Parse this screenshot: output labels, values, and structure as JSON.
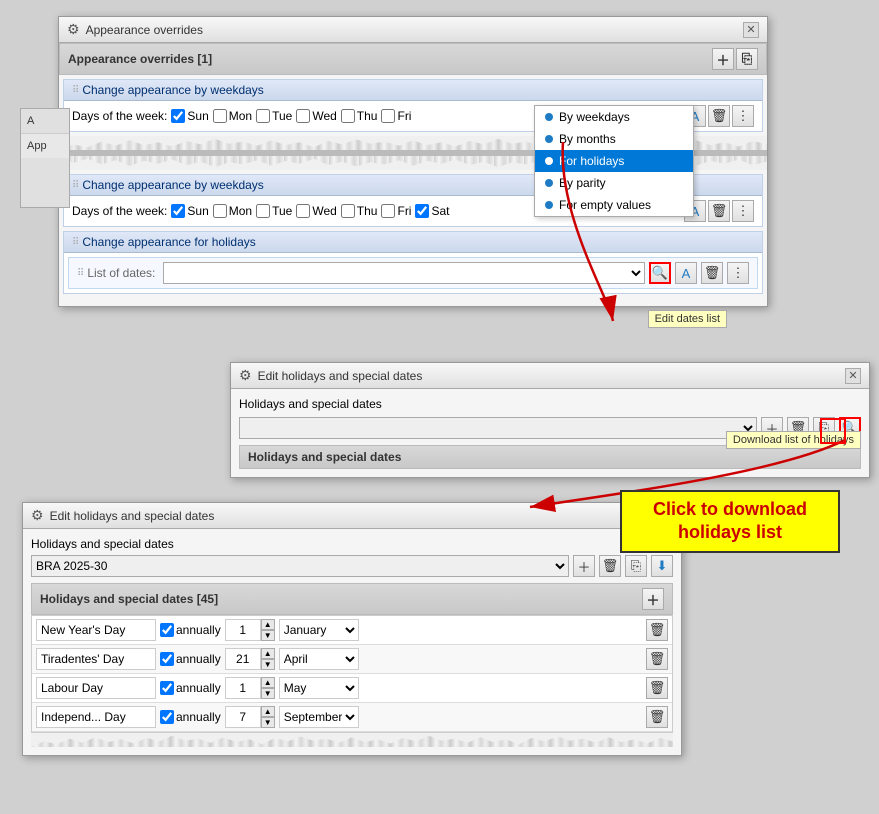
{
  "window1": {
    "title": "Appearance overrides",
    "section_label": "Appearance overrides [1]",
    "subsection1_title": "Change appearance by weekdays",
    "days_label": "Days of the week:",
    "days1": [
      "Sun",
      "Mon",
      "Tue",
      "Wed",
      "Thu",
      "Fri"
    ],
    "days1_checked": [
      true,
      false,
      false,
      false,
      false,
      false
    ],
    "subsection2_title": "Change appearance by weekdays",
    "days2": [
      "Sun",
      "Mon",
      "Tue",
      "Wed",
      "Thu",
      "Fri",
      "Sat"
    ],
    "days2_checked": [
      true,
      false,
      false,
      false,
      false,
      false,
      true
    ],
    "subsection3_title": "Change appearance for holidays",
    "list_of_dates_label": "List of dates:",
    "edit_dates_tooltip": "Edit dates list"
  },
  "dropdown_menu": {
    "items": [
      {
        "label": "By weekdays",
        "selected": false
      },
      {
        "label": "By months",
        "selected": false
      },
      {
        "label": "For holidays",
        "selected": true
      },
      {
        "label": "By parity",
        "selected": false
      },
      {
        "label": "For empty values",
        "selected": false
      }
    ]
  },
  "window2": {
    "title": "Edit holidays and special dates",
    "section_label": "Holidays and special dates",
    "header_label": "Holidays and special dates",
    "download_tooltip": "Download list of holidays"
  },
  "window3": {
    "title": "Edit holidays and special dates",
    "section_label": "Holidays and special dates",
    "dropdown_value": "BRA 2025-30",
    "table_header": "Holidays and special dates [45]",
    "holidays": [
      {
        "name": "New Year's Day",
        "annually": true,
        "day": 1,
        "month": "January"
      },
      {
        "name": "Tiradentes' Day",
        "annually": true,
        "day": 21,
        "month": "April"
      },
      {
        "name": "Labour Day",
        "annually": true,
        "day": 1,
        "month": "May"
      },
      {
        "name": "Independ... Day",
        "annually": true,
        "day": 7,
        "month": "September"
      }
    ]
  },
  "annotation": {
    "text": "Click to download holidays list"
  },
  "labels": {
    "annually": "annually",
    "close_x": "✕",
    "gear": "⚙",
    "add": "＋",
    "delete": "🗑",
    "font": "A",
    "more": "⋮",
    "search": "🔍",
    "download": "⬇"
  }
}
